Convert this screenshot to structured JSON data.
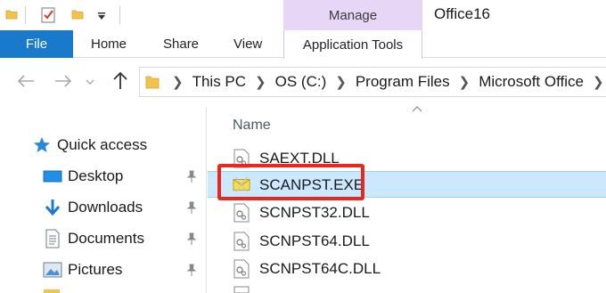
{
  "window": {
    "title": "Office16"
  },
  "contextual_tab": {
    "group_label": "Manage",
    "tab_label": "Application Tools"
  },
  "ribbon": {
    "file_label": "File",
    "tabs": [
      {
        "label": "Home"
      },
      {
        "label": "Share"
      },
      {
        "label": "View"
      }
    ]
  },
  "address": {
    "crumbs": [
      "This PC",
      "OS (C:)",
      "Program Files",
      "Microsoft Office"
    ]
  },
  "navpane": {
    "items": [
      {
        "label": "Quick access",
        "icon": "star-icon",
        "pinned": false
      },
      {
        "label": "Desktop",
        "icon": "desktop-icon",
        "pinned": true
      },
      {
        "label": "Downloads",
        "icon": "download-icon",
        "pinned": true
      },
      {
        "label": "Documents",
        "icon": "documents-icon",
        "pinned": true
      },
      {
        "label": "Pictures",
        "icon": "pictures-icon",
        "pinned": true
      }
    ]
  },
  "filelist": {
    "column_header": "Name",
    "files": [
      {
        "name": "SAEXT.DLL",
        "icon": "dll-file-icon",
        "selected": false
      },
      {
        "name": "SCANPST.EXE",
        "icon": "scanpst-exe-icon",
        "selected": true
      },
      {
        "name": "SCNPST32.DLL",
        "icon": "dll-file-icon",
        "selected": false
      },
      {
        "name": "SCNPST64.DLL",
        "icon": "dll-file-icon",
        "selected": false
      },
      {
        "name": "SCNPST64C.DLL",
        "icon": "dll-file-icon",
        "selected": false
      }
    ]
  },
  "colors": {
    "file_tab": "#1979ca",
    "manage_tab": "#e8d6f7",
    "selection": "#cce8ff",
    "highlight_box": "#e8281c",
    "folder": "#f3c24a"
  }
}
